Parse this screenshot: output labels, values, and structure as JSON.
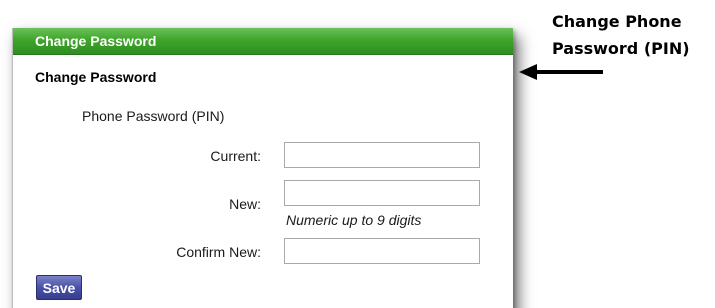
{
  "panel": {
    "header_title": "Change Password",
    "section_title": "Change Password",
    "subsection_label": "Phone Password (PIN)",
    "fields": {
      "current": {
        "label": "Current:",
        "value": "",
        "placeholder": ""
      },
      "new": {
        "label": "New:",
        "value": "",
        "placeholder": "",
        "hint": "Numeric up to 9 digits"
      },
      "confirm": {
        "label": "Confirm New:",
        "value": "",
        "placeholder": ""
      }
    },
    "save_label": "Save"
  },
  "callout": {
    "line1": "Change Phone",
    "line2": "Password (PIN)",
    "icon": "arrow-left-icon"
  },
  "colors": {
    "header_green": "#3fa52b",
    "button_blue": "#4a52a8"
  }
}
